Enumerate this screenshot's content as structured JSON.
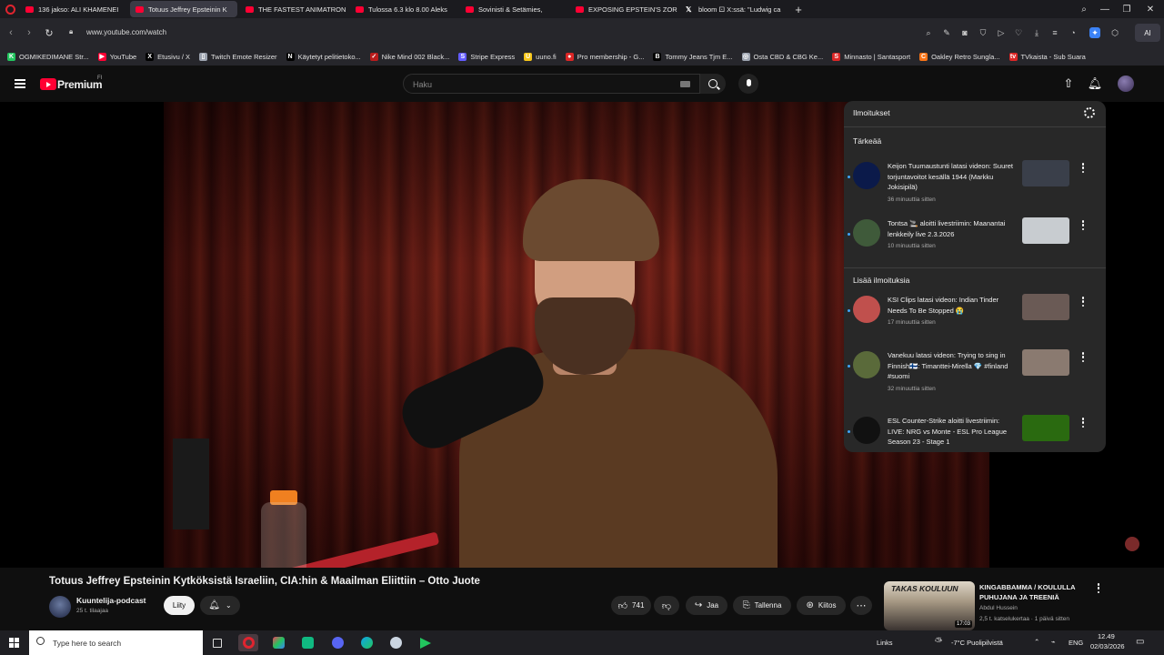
{
  "browser": {
    "tabs": [
      {
        "label": "136 jakso: ALI KHAMENEI",
        "favicon": "youtube-icon",
        "active": false
      },
      {
        "label": "Totuus Jeffrey Epsteinin K",
        "favicon": "youtube-icon",
        "active": true
      },
      {
        "label": "THE FASTEST ANIMATRON",
        "favicon": "youtube-icon",
        "active": false
      },
      {
        "label": "Tulossa 6.3 klo 8.00 Aleks",
        "favicon": "youtube-icon",
        "active": false
      },
      {
        "label": "Sovinisti & Setämies,",
        "favicon": "youtube-icon",
        "active": false
      },
      {
        "label": "EXPOSING EPSTEIN'S ZOR",
        "favicon": "youtube-icon",
        "active": false
      },
      {
        "label": "bloom ⚀ X:ssä: \"Ludwig ca",
        "favicon": "x-icon",
        "active": false
      }
    ],
    "new_tab_symbol": "+",
    "url": "www.youtube.com/watch",
    "ai_label": "AI",
    "bookmarks": [
      {
        "label": "OGMIKEDIMANE Str...",
        "color": "#22c55e",
        "glyph": "K"
      },
      {
        "label": "YouTube",
        "color": "#ff0033",
        "glyph": "▶"
      },
      {
        "label": "Etusivu / X",
        "color": "#000000",
        "glyph": "X"
      },
      {
        "label": "Twitch Emote Resizer",
        "color": "#9ca3af",
        "glyph": "▯"
      },
      {
        "label": "Käytetyt pelitietoko...",
        "color": "#000000",
        "glyph": "N"
      },
      {
        "label": "Nike Mind 002 Black...",
        "color": "#b91c1c",
        "glyph": "✓"
      },
      {
        "label": "Stripe Express",
        "color": "#635bff",
        "glyph": "S"
      },
      {
        "label": "uuno.fi",
        "color": "#f5c518",
        "glyph": "U"
      },
      {
        "label": "Pro membership - G...",
        "color": "#dc2626",
        "glyph": "●"
      },
      {
        "label": "Tommy Jeans Tjm E...",
        "color": "#000000",
        "glyph": "B"
      },
      {
        "label": "Osta CBD & CBG Ke...",
        "color": "#9ca3af",
        "glyph": "◎"
      },
      {
        "label": "Minnasto | Santasport",
        "color": "#dc2626",
        "glyph": "S"
      },
      {
        "label": "Oakley Retro Sungla...",
        "color": "#f97316",
        "glyph": "C"
      },
      {
        "label": "TVkaista - Sub Suara",
        "color": "#dc2626",
        "glyph": "tv"
      }
    ]
  },
  "youtube": {
    "brand": "Premium",
    "region": "FI",
    "search_placeholder": "Haku",
    "video": {
      "title": "Totuus Jeffrey Epsteinin Kytköksistä Israeliin, CIA:hin & Maailman Eliittiin – Otto Juote",
      "channel": "Kuuntelija-podcast",
      "subscribers": "25 t. tilaajaa",
      "join_label": "Liity",
      "likes": "741",
      "share_label": "Jaa",
      "save_label": "Tallenna",
      "thanks_label": "Kiitos"
    },
    "notifications": {
      "title": "Ilmoitukset",
      "section_important": "Tärkeää",
      "section_more": "Lisää ilmoituksia",
      "items": [
        {
          "text": "Keijon Tuumaustunti latasi videon: Suuret torjuntavoitot kesällä 1944 (Markku Jokisipilä)",
          "time": "36 minuuttia sitten",
          "avatar_color": "#0b1a4a",
          "thumb_color": "#3a3f4a"
        },
        {
          "text": "Tontsa 🚬 aloitti livestriimin: Maanantai lenkkeily live 2.3.2026",
          "time": "10 minuuttia sitten",
          "avatar_color": "#3f5a3a",
          "thumb_color": "#c8ccd0"
        },
        {
          "text": "KSI Clips latasi videon: Indian Tinder Needs To Be Stopped 😭",
          "time": "17 minuuttia sitten",
          "avatar_color": "#c0504d",
          "thumb_color": "#6a5a55"
        },
        {
          "text": "Vanekuu latasi videon: Trying to sing in Finnish🇫🇮: Timanttei-Mirella 💎 #finland #suomi",
          "time": "32 minuuttia sitten",
          "avatar_color": "#5a6a3a",
          "thumb_color": "#8a7a70"
        },
        {
          "text": "ESL Counter-Strike aloitti livestriimin: LIVE: NRG vs Monte - ESL Pro League Season 23 - Stage 1",
          "time": "",
          "avatar_color": "#111111",
          "thumb_color": "#2a6a10"
        }
      ]
    },
    "recommended": {
      "thumb_text": "TAKAS KOULUUN",
      "duration": "17:03",
      "title": "KINGABBAMMA / KOULULLA PUHUJANA JA TREENIÄ",
      "channel": "Abdul Hussein",
      "meta": "2,5 t. katselukertaa · 1 päivä sitten"
    }
  },
  "taskbar": {
    "search_placeholder": "Type here to search",
    "links_label": "Links",
    "weather": "-7°C  Puolipilvistä",
    "language": "ENG",
    "time": "12.49",
    "date": "02/03/2026"
  }
}
